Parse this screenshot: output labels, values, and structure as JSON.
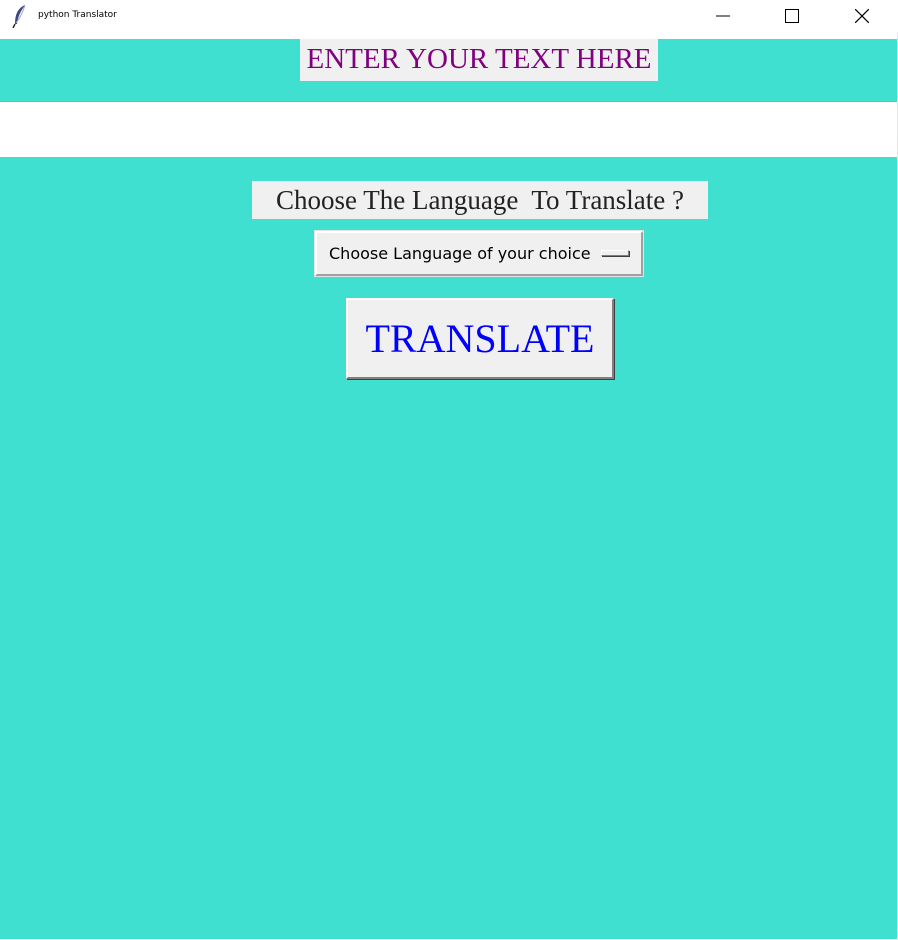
{
  "window": {
    "title": "python Translator",
    "background": "#40e0d0"
  },
  "header": {
    "label": "ENTER YOUR TEXT HERE",
    "color": "#800080"
  },
  "text_input": {
    "value": "",
    "placeholder": ""
  },
  "language_prompt": {
    "label": "Choose The Language  To Translate ?"
  },
  "language_dropdown": {
    "selected": "Choose Language of your choice"
  },
  "translate_button": {
    "label": "TRANSLATE",
    "color": "#0000ff"
  },
  "icons": {
    "app": "feather-icon",
    "minimize": "minimize-icon",
    "maximize": "maximize-icon",
    "close": "close-icon"
  }
}
